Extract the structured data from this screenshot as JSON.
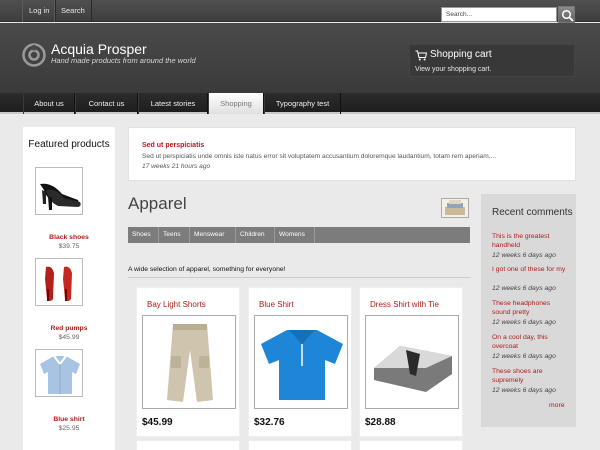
{
  "topbar": {
    "login": "Log in",
    "search": "Search",
    "search_placeholder": "Search..."
  },
  "header": {
    "site_name": "Acquia Prosper",
    "slogan": "Hand made products from around the world"
  },
  "cart": {
    "title": "Shopping cart",
    "link": "View your shopping cart."
  },
  "nav": [
    "About us",
    "Contact us",
    "Latest stories",
    "Shopping",
    "Typography test"
  ],
  "nav_active": "Shopping",
  "featured": {
    "title": "Featured products",
    "items": [
      {
        "name": "Black shoes",
        "price": "$39.75"
      },
      {
        "name": "Red pumps",
        "price": "$45.99"
      },
      {
        "name": "Blue shirt",
        "price": "$25.95"
      }
    ]
  },
  "notice": {
    "title": "Sed ut perspiciatis",
    "body": "Sed ut perspiciatis unde omnis iste natus error sit voluptatem accusantium doloremque laudantium, totam rem aperiam,...",
    "time": "17 weeks 21 hours ago"
  },
  "main": {
    "title": "Apparel",
    "tabs": [
      "Shoes",
      "Teens",
      "Menswear",
      "Children",
      "Womens"
    ],
    "description": "A wide selection of apparel, something for everyone!",
    "products": [
      {
        "name": "Bay Light Shorts",
        "price": "$45.99"
      },
      {
        "name": "Blue Shirt",
        "price": "$32.76"
      },
      {
        "name": "Dress Shirt with Tie",
        "price": "$28.88"
      }
    ]
  },
  "recent_comments": {
    "title": "Recent comments",
    "items": [
      {
        "text": "This is the greatest handheld",
        "time": "12 weeks 6 days ago"
      },
      {
        "text": "I got one of these for my",
        "time": "12 weeks 6 days ago"
      },
      {
        "text": "These headphones sound pretty",
        "time": "12 weeks 6 days ago"
      },
      {
        "text": "On a cool day, this overcoat",
        "time": "12 weeks 6 days ago"
      },
      {
        "text": "These shoes are supremely",
        "time": "12 weeks 6 days ago"
      }
    ],
    "more": "more"
  },
  "colors": {
    "accent_red": "#b01c1c",
    "header_dark": "#404040",
    "nav_dark": "#222222"
  }
}
